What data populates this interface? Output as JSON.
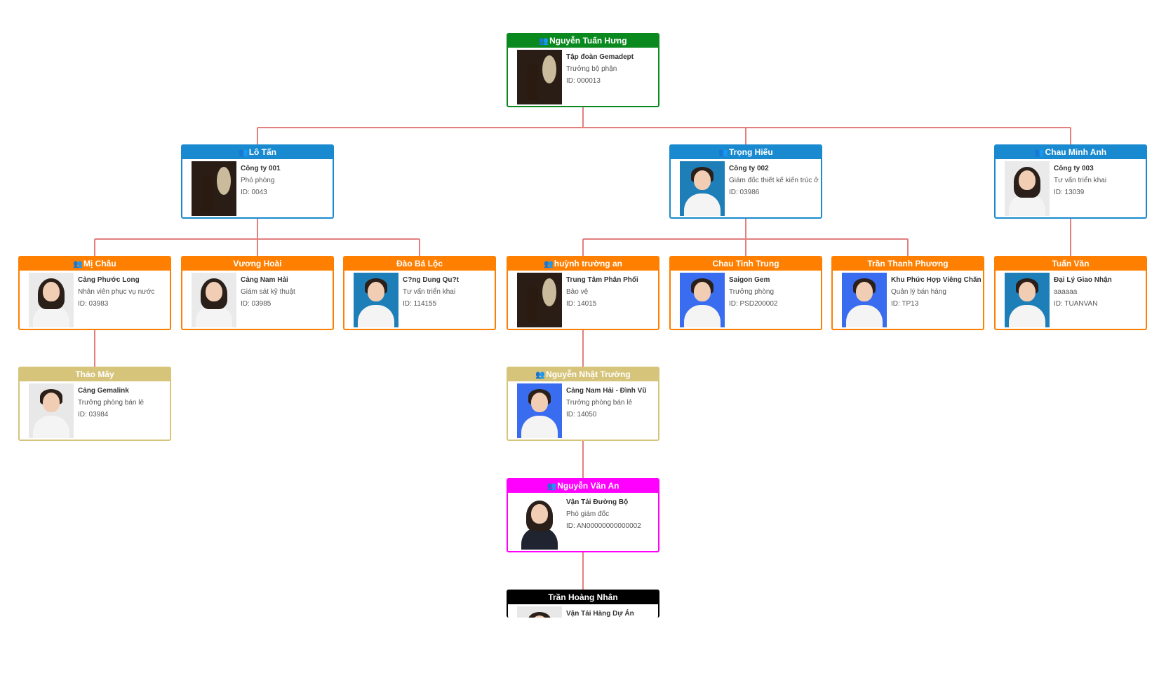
{
  "colors": {
    "green": "#0a8a1e",
    "blue": "#1a8ad0",
    "orange": "#ff7f00",
    "tan": "#d6c47a",
    "magenta": "#ff00ff",
    "black": "#000000",
    "connector": "#e37f7f"
  },
  "nodes": [
    {
      "name": "Nguyễn Tuấn Hưng",
      "icon": true,
      "company": "Tập đoàn Gemadept",
      "title": "Trưởng bộ phận",
      "id": "ID: 000013",
      "color": "green",
      "photo": "scene",
      "bg": "#2a1d15"
    },
    {
      "name": "Lô Tấn",
      "icon": true,
      "company": "Công ty 001",
      "title": "Phó phòng",
      "id": "ID: 0043",
      "color": "blue",
      "photo": "scene",
      "bg": "#2a1d15"
    },
    {
      "name": "Trọng Hiếu",
      "icon": true,
      "company": "Công ty 002",
      "title": "Giám đốc thiết kế kiến trúc ở",
      "id": "ID: 03986",
      "color": "blue",
      "photo": "man",
      "bg": "#1e7fb8"
    },
    {
      "name": "Chau Minh Anh",
      "icon": true,
      "company": "Công ty 003",
      "title": "Tư vấn triển khai",
      "id": "ID: 13039",
      "color": "blue",
      "photo": "woman",
      "bg": "#eaeaea"
    },
    {
      "name": "Mị Châu",
      "icon": true,
      "company": "Cảng Phước Long",
      "title": "Nhân viên phục vụ nước",
      "id": "ID: 03983",
      "color": "orange",
      "photo": "woman",
      "bg": "#eaeaea"
    },
    {
      "name": "Vương Hoài",
      "icon": false,
      "company": "Cảng Nam Hải",
      "title": "Giám sát kỹ thuật",
      "id": "ID: 03985",
      "color": "orange",
      "photo": "woman",
      "bg": "#eaeaea"
    },
    {
      "name": "Đào Bá Lộc",
      "icon": false,
      "company": "C?ng Dung Qu?t",
      "title": "Tư vấn triển khai",
      "id": "ID: 114155",
      "color": "orange",
      "photo": "man",
      "bg": "#1e7fb8"
    },
    {
      "name": "huỳnh trường an",
      "icon": true,
      "company": "Trung Tâm Phân Phối",
      "title": "Bảo vệ",
      "id": "ID: 14015",
      "color": "orange",
      "photo": "scene",
      "bg": "#2a1d15"
    },
    {
      "name": "Chau Tinh Trung",
      "icon": false,
      "company": "Saigon Gem",
      "title": "Trưởng phòng",
      "id": "ID: PSD200002",
      "color": "orange",
      "photo": "woman-short",
      "bg": "#3a6cf0"
    },
    {
      "name": "Trần Thanh Phương",
      "icon": false,
      "company": "Khu Phức Hợp Viêng Chăn -",
      "title": "Quản lý bán hàng",
      "id": "ID: TP13",
      "color": "orange",
      "photo": "woman-short",
      "bg": "#3a6cf0"
    },
    {
      "name": "Tuấn Văn",
      "icon": false,
      "company": "Đại Lý Giao Nhận",
      "title": "aaaaaa",
      "id": "ID: TUANVAN",
      "color": "orange",
      "photo": "man",
      "bg": "#1e7fb8"
    },
    {
      "name": "Thảo Mây",
      "icon": false,
      "company": "Cảng Gemalink",
      "title": "Trưởng phòng bán lẻ",
      "id": "ID: 03984",
      "color": "tan",
      "photo": "man-light",
      "bg": "#e8e8e8"
    },
    {
      "name": "Nguyễn Nhật Trường",
      "icon": true,
      "company": "Cảng Nam Hải - Đình Vũ",
      "title": "Trưởng phòng bán lẻ",
      "id": "ID: 14050",
      "color": "tan",
      "photo": "woman-short",
      "bg": "#3a6cf0"
    },
    {
      "name": "Nguyễn Văn An",
      "icon": true,
      "company": "Vận Tải Đường Bộ",
      "title": "Phó giám đốc",
      "id": "ID: AN00000000000002",
      "color": "magenta",
      "photo": "woman-suit",
      "bg": "#ffffff"
    },
    {
      "name": "Trần Hoàng Nhân",
      "icon": false,
      "company": "Vận Tải Hàng Dự Án",
      "title": "",
      "id": "",
      "color": "black",
      "photo": "man-light",
      "bg": "#e8e8e8"
    }
  ]
}
